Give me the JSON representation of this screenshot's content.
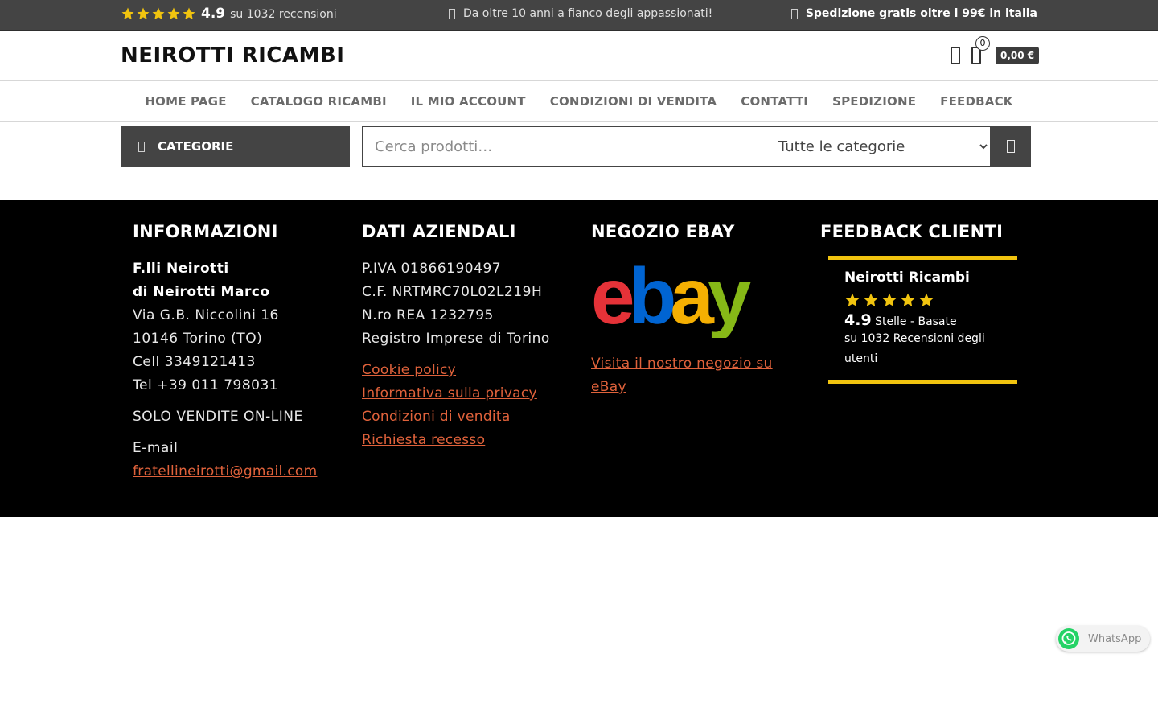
{
  "topbar": {
    "rating": "4.9",
    "reviews": "su 1032 recensioni",
    "center_text": "Da oltre 10 anni a fianco degli appassionati!",
    "right_text": "Spedizione gratis oltre i 99€ in italia",
    "star_color": "#f1c40f"
  },
  "header": {
    "logo": "NEIROTTI RICAMBI",
    "cart_count": "0",
    "cart_total": "0,00 €"
  },
  "nav": {
    "items": [
      "HOME PAGE",
      "CATALOGO RICAMBI",
      "IL MIO ACCOUNT",
      "CONDIZIONI DI VENDITA",
      "CONTATTI",
      "SPEDIZIONE",
      "FEEDBACK"
    ]
  },
  "search": {
    "categories_label": "CATEGORIE",
    "placeholder": "Cerca prodotti…",
    "select_value": "Tutte le categorie"
  },
  "footer": {
    "info": {
      "title": "INFORMAZIONI",
      "company_line1": "F.lli Neirotti",
      "company_line2": "di Neirotti Marco",
      "address1": "Via G.B. Niccolini 16",
      "address2": "10146 Torino (TO)",
      "cell": "Cell 3349121413",
      "tel": "Tel +39 011 798031",
      "online_only": "SOLO VENDITE ON-LINE",
      "email_label": "E-mail",
      "email": "fratellineirotti@gmail.com"
    },
    "company": {
      "title": "DATI AZIENDALI",
      "piva": "P.IVA 01866190497",
      "cf": "C.F. NRTMRC70L02L219H",
      "rea": "N.ro REA 1232795",
      "registry": "Registro Imprese di Torino",
      "links": [
        "Cookie policy",
        "Informativa sulla privacy",
        "Condizioni di vendita",
        "Richiesta recesso"
      ]
    },
    "ebay": {
      "title": "NEGOZIO EBAY",
      "link": "Visita il nostro negozio su eBay"
    },
    "feedback": {
      "title": "FEEDBACK CLIENTI",
      "name": "Neirotti Ricambi",
      "score": "4.9",
      "stelle_text": "Stelle - Basate",
      "line2": "su 1032 Recensioni degli utenti"
    },
    "accent_color": "#f1c40f",
    "link_color": "#e0623b"
  },
  "whatsapp": {
    "label": "WhatsApp"
  }
}
